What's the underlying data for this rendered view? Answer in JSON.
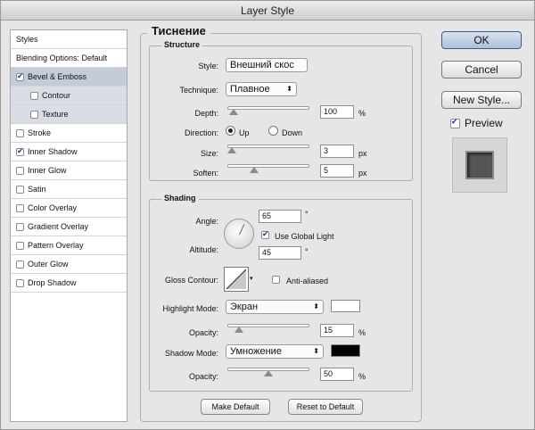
{
  "window": {
    "title": "Layer Style"
  },
  "sidebar": {
    "items": [
      {
        "label": "Styles",
        "checkbox": false,
        "checked": false,
        "selected": false,
        "sub": false
      },
      {
        "label": "Blending Options: Default",
        "checkbox": false,
        "checked": false,
        "selected": false,
        "sub": false
      },
      {
        "label": "Bevel & Emboss",
        "checkbox": true,
        "checked": true,
        "selected": true,
        "sub": false
      },
      {
        "label": "Contour",
        "checkbox": true,
        "checked": false,
        "selected": false,
        "sub": true
      },
      {
        "label": "Texture",
        "checkbox": true,
        "checked": false,
        "selected": false,
        "sub": true
      },
      {
        "label": "Stroke",
        "checkbox": true,
        "checked": false,
        "selected": false,
        "sub": false
      },
      {
        "label": "Inner Shadow",
        "checkbox": true,
        "checked": true,
        "selected": false,
        "sub": false
      },
      {
        "label": "Inner Glow",
        "checkbox": true,
        "checked": false,
        "selected": false,
        "sub": false
      },
      {
        "label": "Satin",
        "checkbox": true,
        "checked": false,
        "selected": false,
        "sub": false
      },
      {
        "label": "Color Overlay",
        "checkbox": true,
        "checked": false,
        "selected": false,
        "sub": false
      },
      {
        "label": "Gradient Overlay",
        "checkbox": true,
        "checked": false,
        "selected": false,
        "sub": false
      },
      {
        "label": "Pattern Overlay",
        "checkbox": true,
        "checked": false,
        "selected": false,
        "sub": false
      },
      {
        "label": "Outer Glow",
        "checkbox": true,
        "checked": false,
        "selected": false,
        "sub": false
      },
      {
        "label": "Drop Shadow",
        "checkbox": true,
        "checked": false,
        "selected": false,
        "sub": false
      }
    ]
  },
  "main": {
    "title": "Тиснение",
    "structure": {
      "title": "Structure",
      "style_label": "Style:",
      "style_value": "Внешний скос",
      "technique_label": "Technique:",
      "technique_value": "Плавное",
      "depth_label": "Depth:",
      "depth_value": "100",
      "depth_unit": "%",
      "direction_label": "Direction:",
      "up_label": "Up",
      "down_label": "Down",
      "size_label": "Size:",
      "size_value": "3",
      "size_unit": "px",
      "soften_label": "Soften:",
      "soften_value": "5",
      "soften_unit": "px"
    },
    "shading": {
      "title": "Shading",
      "angle_label": "Angle:",
      "angle_value": "65",
      "degree": "°",
      "use_global_light": "Use Global Light",
      "altitude_label": "Altitude:",
      "altitude_value": "45",
      "gloss_contour_label": "Gloss Contour:",
      "anti_aliased": "Anti-aliased",
      "highlight_mode_label": "Highlight Mode:",
      "highlight_mode_value": "Экран",
      "highlight_color": "#ffffff",
      "highlight_opacity_label": "Opacity:",
      "highlight_opacity_value": "15",
      "shadow_mode_label": "Shadow Mode:",
      "shadow_mode_value": "Умножение",
      "shadow_color": "#000000",
      "shadow_opacity_label": "Opacity:",
      "shadow_opacity_value": "50",
      "percent": "%"
    },
    "make_default": "Make Default",
    "reset_default": "Reset to Default"
  },
  "actions": {
    "ok": "OK",
    "cancel": "Cancel",
    "new_style": "New Style...",
    "preview": "Preview"
  }
}
